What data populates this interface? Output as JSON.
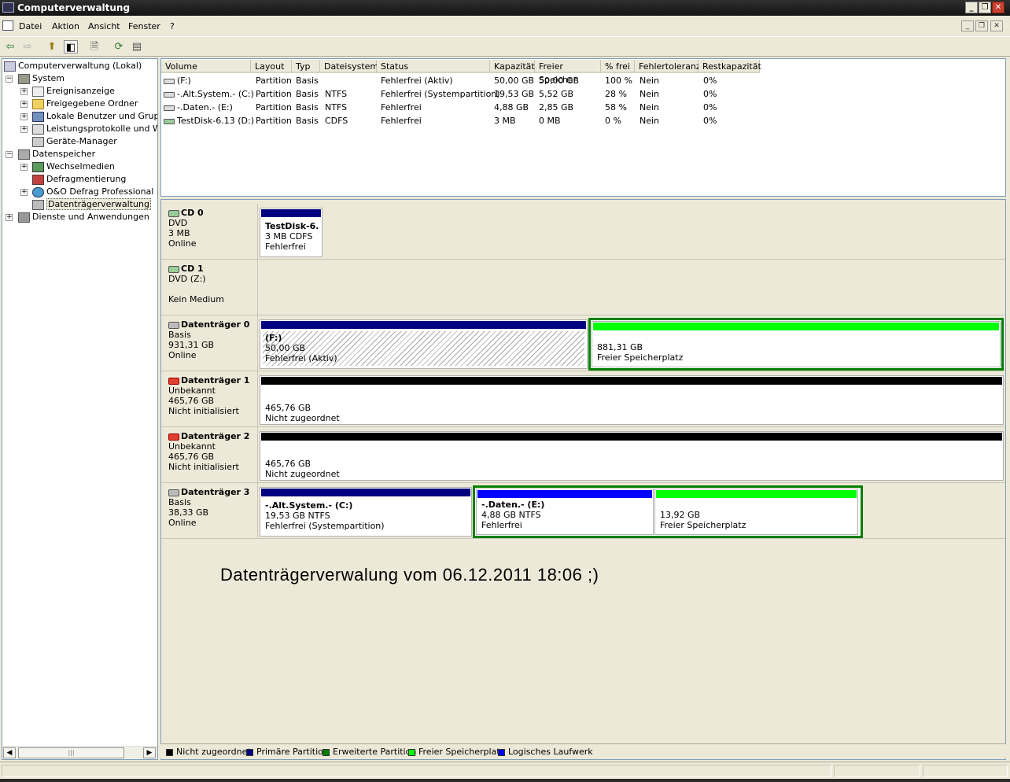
{
  "window": {
    "title": "Computerverwaltung"
  },
  "menu": [
    "Datei",
    "Aktion",
    "Ansicht",
    "Fenster",
    "?"
  ],
  "tree": {
    "root": "Computerverwaltung (Lokal)",
    "items": [
      {
        "label": "System"
      },
      {
        "label": "Ereignisanzeige"
      },
      {
        "label": "Freigegebene Ordner"
      },
      {
        "label": "Lokale Benutzer und Gruppen"
      },
      {
        "label": "Leistungsprotokolle und Warn"
      },
      {
        "label": "Geräte-Manager"
      },
      {
        "label": "Datenspeicher"
      },
      {
        "label": "Wechselmedien"
      },
      {
        "label": "Defragmentierung"
      },
      {
        "label": "O&O Defrag Professional Edi"
      },
      {
        "label": "Datenträgerverwaltung"
      },
      {
        "label": "Dienste und Anwendungen"
      }
    ]
  },
  "columns": [
    "Volume",
    "Layout",
    "Typ",
    "Dateisystem",
    "Status",
    "Kapazität",
    "Freier Speicher",
    "% frei",
    "Fehlertoleranz",
    "Restkapazität"
  ],
  "rows": [
    [
      "(F:)",
      "Partition",
      "Basis",
      "",
      "Fehlerfrei (Aktiv)",
      "50,00 GB",
      "50,00 GB",
      "100 %",
      "Nein",
      "0%"
    ],
    [
      "-.Alt.System.- (C:)",
      "Partition",
      "Basis",
      "NTFS",
      "Fehlerfrei (Systempartition)",
      "19,53 GB",
      "5,52 GB",
      "28 %",
      "Nein",
      "0%"
    ],
    [
      "-.Daten.- (E:)",
      "Partition",
      "Basis",
      "NTFS",
      "Fehlerfrei",
      "4,88 GB",
      "2,85 GB",
      "58 %",
      "Nein",
      "0%"
    ],
    [
      "TestDisk-6.13 (D:)",
      "Partition",
      "Basis",
      "CDFS",
      "Fehlerfrei",
      "3 MB",
      "0 MB",
      "0 %",
      "Nein",
      "0%"
    ]
  ],
  "disks": {
    "cd0": {
      "name": "CD 0",
      "type": "DVD",
      "size": "3 MB",
      "state": "Online",
      "p1": {
        "name": "TestDisk-6.",
        "l2": "3 MB CDFS",
        "l3": "Fehlerfrei"
      }
    },
    "cd1": {
      "name": "CD 1",
      "type": "DVD (Z:)",
      "state": "Kein Medium"
    },
    "d0": {
      "name": "Datenträger 0",
      "type": "Basis",
      "size": "931,31 GB",
      "state": "Online",
      "p1": {
        "name": "(F:)",
        "l2": "50,00 GB",
        "l3": "Fehlerfrei (Aktiv)"
      },
      "p2": {
        "l2": "881,31 GB",
        "l3": "Freier Speicherplatz"
      }
    },
    "d1": {
      "name": "Datenträger 1",
      "type": "Unbekannt",
      "size": "465,76 GB",
      "state": "Nicht initialisiert",
      "p1": {
        "l2": "465,76 GB",
        "l3": "Nicht zugeordnet"
      }
    },
    "d2": {
      "name": "Datenträger 2",
      "type": "Unbekannt",
      "size": "465,76 GB",
      "state": "Nicht initialisiert",
      "p1": {
        "l2": "465,76 GB",
        "l3": "Nicht zugeordnet"
      }
    },
    "d3": {
      "name": "Datenträger 3",
      "type": "Basis",
      "size": "38,33 GB",
      "state": "Online",
      "p1": {
        "name": "-.Alt.System.-  (C:)",
        "l2": "19,53 GB NTFS",
        "l3": "Fehlerfrei (Systempartition)"
      },
      "p2": {
        "name": "-.Daten.-  (E:)",
        "l2": "4,88 GB NTFS",
        "l3": "Fehlerfrei"
      },
      "p3": {
        "l2": "13,92 GB",
        "l3": "Freier Speicherplatz"
      }
    }
  },
  "note": "Datenträgerverwalung vom 06.12.2011 18:06 ;)",
  "legend": [
    {
      "label": "Nicht zugeordnet",
      "color": "#000000"
    },
    {
      "label": "Primäre Partition",
      "color": "#000080"
    },
    {
      "label": "Erweiterte Partition",
      "color": "#008000"
    },
    {
      "label": "Freier Speicherplatz",
      "color": "#00ff00"
    },
    {
      "label": "Logisches Laufwerk",
      "color": "#0000ff"
    }
  ],
  "colors": {
    "primary": "#000080",
    "unallocated": "#000000",
    "extended": "#008000",
    "free": "#00ff00",
    "logical": "#0000ff"
  }
}
